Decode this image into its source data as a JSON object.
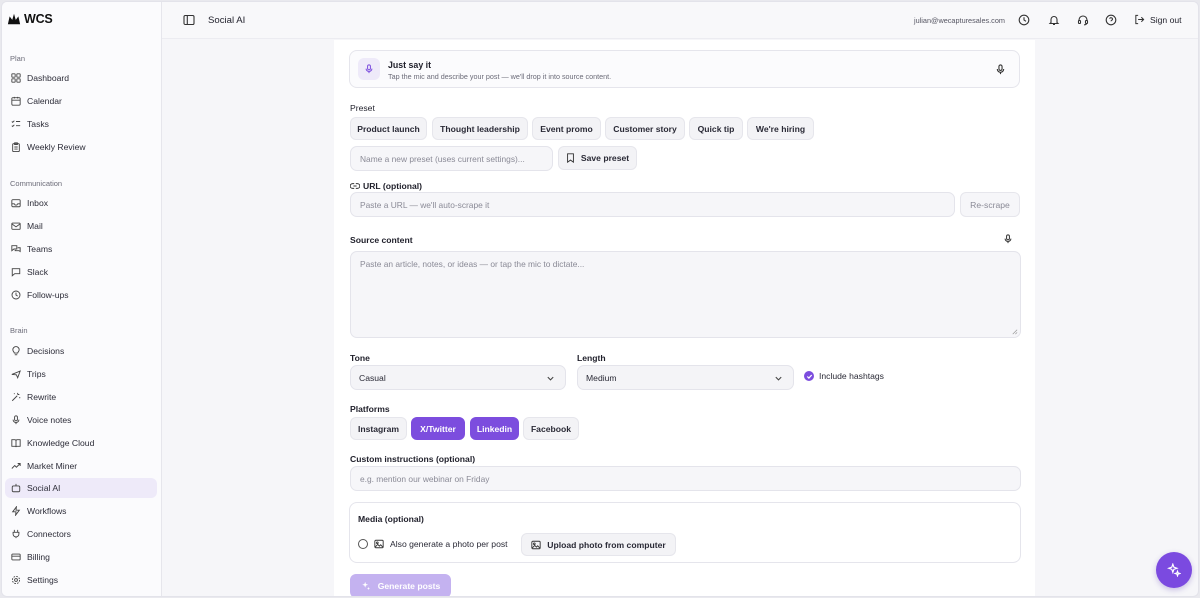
{
  "brand": {
    "name": "WCS"
  },
  "sidebar": {
    "sections": [
      {
        "label": "Plan",
        "items": [
          "Dashboard",
          "Calendar",
          "Tasks",
          "Weekly Review"
        ]
      },
      {
        "label": "Communication",
        "items": [
          "Inbox",
          "Mail",
          "Teams",
          "Slack",
          "Follow-ups"
        ]
      },
      {
        "label": "Brain",
        "items": [
          "Decisions",
          "Trips",
          "Rewrite",
          "Voice notes",
          "Knowledge Cloud",
          "Market Miner",
          "Social AI",
          "Workflows",
          "Connectors",
          "Billing",
          "Settings"
        ]
      }
    ],
    "active_item": "Social AI"
  },
  "header": {
    "title": "Social AI",
    "email": "julian@wecapturesales.com",
    "sign_out": "Sign out"
  },
  "voice": {
    "title": "Just say it",
    "subtitle": "Tap the mic and describe your post — we'll drop it into source content."
  },
  "preset": {
    "label": "Preset",
    "options": [
      "Product launch",
      "Thought leadership",
      "Event promo",
      "Customer story",
      "Quick tip",
      "We're hiring"
    ],
    "new_placeholder": "Name a new preset (uses current settings)...",
    "save_label": "Save preset"
  },
  "url": {
    "label": "URL (optional)",
    "placeholder": "Paste a URL — we'll auto-scrape it",
    "rescrape_label": "Re-scrape"
  },
  "source": {
    "label": "Source content",
    "placeholder": "Paste an article, notes, or ideas — or tap the mic to dictate..."
  },
  "tone": {
    "label": "Tone",
    "value": "Casual"
  },
  "length": {
    "label": "Length",
    "value": "Medium"
  },
  "hashtags": {
    "label": "Include hashtags",
    "checked": true
  },
  "platforms": {
    "label": "Platforms",
    "options": [
      {
        "name": "Instagram",
        "selected": false
      },
      {
        "name": "X/Twitter",
        "selected": true
      },
      {
        "name": "Linkedin",
        "selected": true
      },
      {
        "name": "Facebook",
        "selected": false
      }
    ]
  },
  "custom": {
    "label": "Custom instructions (optional)",
    "placeholder": "e.g. mention our webinar on Friday"
  },
  "media": {
    "label": "Media (optional)",
    "generate_photo_label": "Also generate a photo per post",
    "upload_label": "Upload photo from computer"
  },
  "generate": {
    "label": "Generate posts"
  },
  "colors": {
    "accent": "#7c4dde",
    "accent_light": "#c9b7f3"
  }
}
